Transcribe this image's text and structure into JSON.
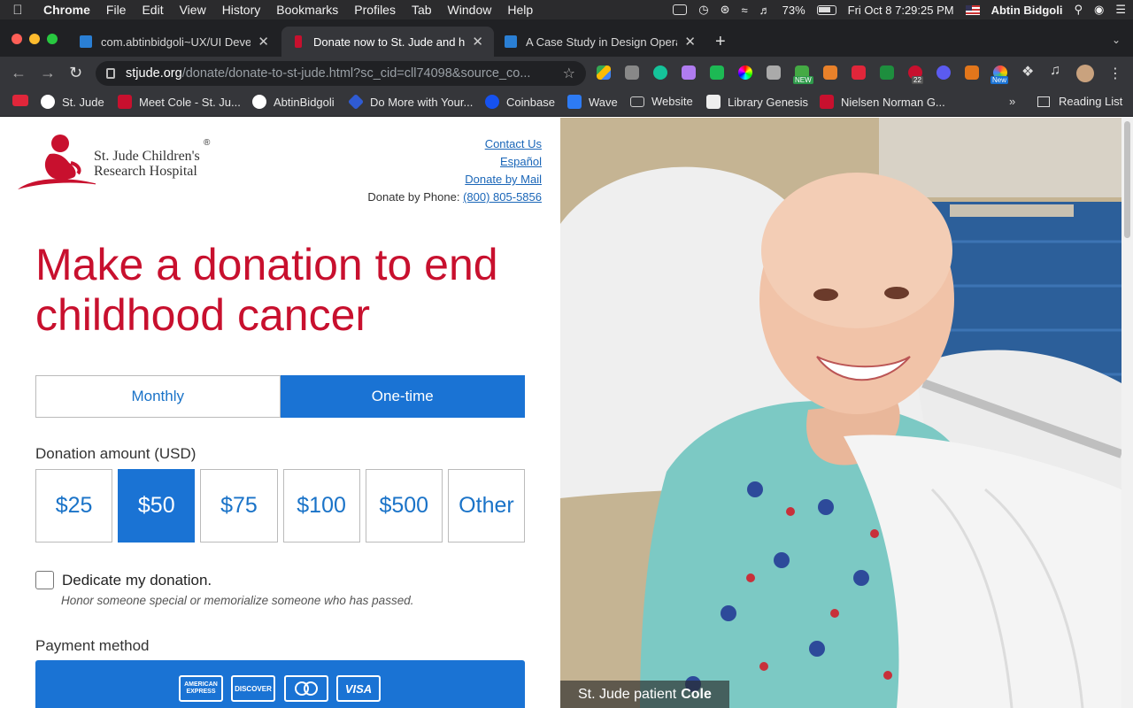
{
  "menubar": {
    "app": "Chrome",
    "items": [
      "File",
      "Edit",
      "View",
      "History",
      "Bookmarks",
      "Profiles",
      "Tab",
      "Window",
      "Help"
    ],
    "battery": "73%",
    "datetime": "Fri Oct 8  7:29:25 PM",
    "user": "Abtin Bidgoli"
  },
  "tabs": [
    {
      "title": "com.abtinbidgoli~UX/UI Develo",
      "active": false
    },
    {
      "title": "Donate now to St. Jude and he",
      "active": true
    },
    {
      "title": "A Case Study in Design Operat",
      "active": false
    }
  ],
  "toolbar": {
    "url_host": "stjude.org",
    "url_path": "/donate/donate-to-st-jude.html?sc_cid=cll74098&source_co...",
    "badges": {
      "new1": "NEW",
      "abp": "22",
      "new2": "New"
    }
  },
  "bookmarks": [
    {
      "label": "St. Jude",
      "color": "#ffffff"
    },
    {
      "label": "Meet Cole - St. Ju...",
      "color": "#c8102e"
    },
    {
      "label": "AbtinBidgoli",
      "color": "#ffffff"
    },
    {
      "label": "Do More with Your...",
      "color": "#2f5bd3"
    },
    {
      "label": "Coinbase",
      "color": "#1652f0"
    },
    {
      "label": "Wave",
      "color": "#2d7bf4"
    },
    {
      "label": "Website",
      "color": "#bbbbbb"
    },
    {
      "label": "Library Genesis",
      "color": "#eeeeee"
    },
    {
      "label": "Nielsen Norman G...",
      "color": "#c8102e"
    }
  ],
  "reading_list": "Reading List",
  "page": {
    "logo_line1": "St. Jude Children's",
    "logo_line2": "Research Hospital",
    "logo_reg": "®",
    "links": {
      "contact": "Contact Us",
      "espanol": "Español",
      "mail": "Donate by Mail",
      "phone_prefix": "Donate by Phone:",
      "phone": "(800) 805-5856"
    },
    "headline": "Make a donation to end childhood cancer",
    "frequency": {
      "monthly": "Monthly",
      "one_time": "One-time",
      "selected": "One-time"
    },
    "amount_label": "Donation amount (USD)",
    "amounts": [
      "$25",
      "$50",
      "$75",
      "$100",
      "$500",
      "Other"
    ],
    "selected_amount": "$50",
    "dedicate_label": "Dedicate my donation.",
    "dedicate_sub": "Honor someone special or memorialize someone who has passed.",
    "payment_label": "Payment method",
    "cards": [
      "AMERICAN EXPRESS",
      "DISCOVER",
      "mastercard",
      "VISA"
    ],
    "caption_prefix": "St. Jude patient",
    "caption_name": "Cole"
  },
  "colors": {
    "brand_red": "#c8102e",
    "accent_blue": "#1a73d4",
    "link_blue": "#1a66b8"
  }
}
